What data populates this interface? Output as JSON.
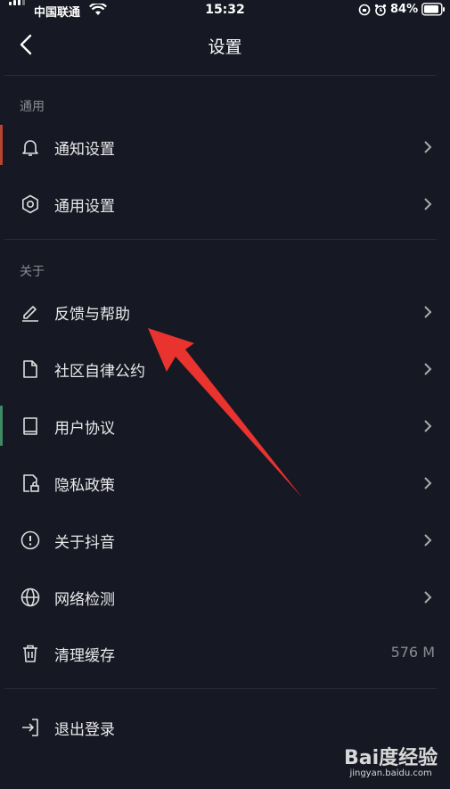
{
  "status_bar": {
    "carrier": "中国联通",
    "time": "15:32",
    "battery": "84%"
  },
  "header": {
    "title": "设置"
  },
  "sections": [
    {
      "label": "通用",
      "items": [
        {
          "label": "通知设置",
          "icon": "bell-icon"
        },
        {
          "label": "通用设置",
          "icon": "gear-icon"
        }
      ]
    },
    {
      "label": "关于",
      "items": [
        {
          "label": "反馈与帮助",
          "icon": "pencil-icon"
        },
        {
          "label": "社区自律公约",
          "icon": "document-icon"
        },
        {
          "label": "用户协议",
          "icon": "book-icon"
        },
        {
          "label": "隐私政策",
          "icon": "lock-document-icon"
        },
        {
          "label": "关于抖音",
          "icon": "info-circle-icon"
        },
        {
          "label": "网络检测",
          "icon": "globe-icon"
        },
        {
          "label": "清理缓存",
          "icon": "trash-icon",
          "value": "576 M"
        }
      ]
    }
  ],
  "logout": {
    "label": "退出登录",
    "icon": "logout-icon"
  },
  "watermark": {
    "brand": "Bai度经验",
    "url": "jingyan.baidu.com"
  },
  "colors": {
    "background": "#161823",
    "annotation_arrow": "#e8332e",
    "secondary_text": "#8a8b91"
  }
}
